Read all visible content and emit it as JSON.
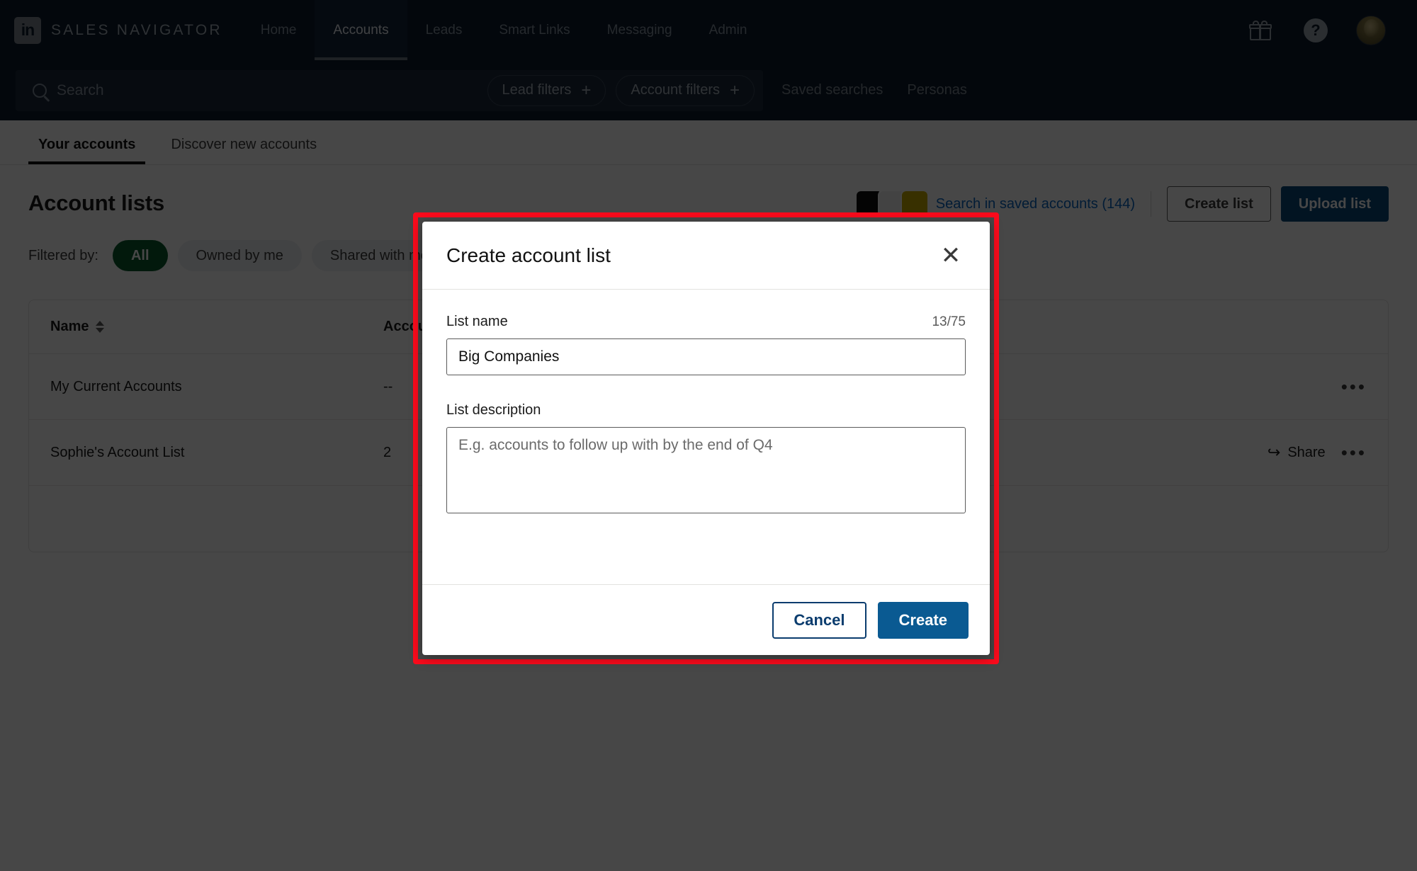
{
  "nav": {
    "brand": "SALES NAVIGATOR",
    "logo_text": "in",
    "items": [
      {
        "label": "Home",
        "active": false
      },
      {
        "label": "Accounts",
        "active": true
      },
      {
        "label": "Leads",
        "active": false
      },
      {
        "label": "Smart Links",
        "active": false
      },
      {
        "label": "Messaging",
        "active": false
      },
      {
        "label": "Admin",
        "active": false
      }
    ],
    "gift_icon": "gift-icon",
    "help_icon": "help-icon",
    "help_glyph": "?",
    "avatar": "user-avatar"
  },
  "search": {
    "placeholder": "Search",
    "search_icon": "search-icon",
    "lead_filters": "Lead filters",
    "account_filters": "Account filters",
    "plus_glyph": "+",
    "saved_searches": "Saved searches",
    "personas": "Personas"
  },
  "tabs": [
    {
      "label": "Your accounts",
      "active": true
    },
    {
      "label": "Discover new accounts",
      "active": false
    }
  ],
  "page": {
    "title": "Account lists",
    "saved_accounts_link": "Search in saved accounts (144)",
    "create_list": "Create list",
    "upload_list": "Upload list",
    "logos": [
      "",
      "",
      ""
    ]
  },
  "filters": {
    "label": "Filtered by:",
    "chips": [
      {
        "label": "All",
        "selected": true
      },
      {
        "label": "Owned by me",
        "selected": false
      },
      {
        "label": "Shared with me",
        "selected": false
      }
    ]
  },
  "table": {
    "headers": {
      "name": "Name",
      "accounts": "Accounts",
      "sort_icon": "sort-icon"
    },
    "rows": [
      {
        "name": "My Current Accounts",
        "accounts": "--",
        "share_label": "",
        "has_share": false,
        "menu": "•••"
      },
      {
        "name": "Sophie's Account List",
        "accounts": "2",
        "share_label": "Share",
        "has_share": true,
        "menu": "•••"
      },
      {
        "name": "",
        "accounts": "",
        "share_label": "",
        "has_share": false,
        "menu": ""
      }
    ]
  },
  "modal": {
    "title": "Create account list",
    "close_icon": "close-icon",
    "close_glyph": "✕",
    "name_label": "List name",
    "name_counter": "13/75",
    "name_value": "Big Companies",
    "name_placeholder": "",
    "description_label": "List description",
    "description_value": "",
    "description_placeholder": "E.g. accounts to follow up with by the end of Q4",
    "cancel_label": "Cancel",
    "create_label": "Create"
  },
  "colors": {
    "nav_bg": "#0b1a2b",
    "accent_link": "#0a66c2",
    "primary_button": "#0a5a92",
    "selected_chip": "#0a5c2e",
    "highlight_border": "#fb0b1c"
  }
}
